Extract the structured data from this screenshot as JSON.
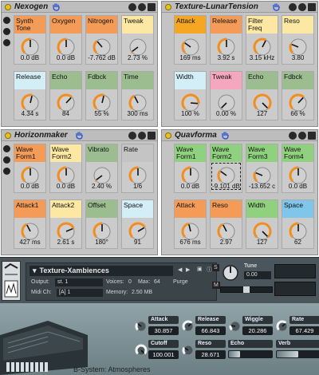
{
  "colors": {
    "orange": "#f49c57",
    "amber": "#f5a623",
    "yellow": "#fde8a3",
    "pink": "#f6a7c0",
    "green": "#8fd17e",
    "sage": "#9bbd8f",
    "lightblue": "#d4eef7",
    "sky": "#80c6ea",
    "grey": "#c4c4c4",
    "knob": "#f28d1e"
  },
  "racks": [
    {
      "name": "Nexogen",
      "macros": [
        {
          "label": "Synth Tone",
          "value": "0.0 dB",
          "color": "orange",
          "level": 0.5
        },
        {
          "label": "Oxygen",
          "value": "0.0 dB",
          "color": "orange",
          "level": 0.5
        },
        {
          "label": "Nitrogen",
          "value": "-7.762 dB",
          "color": "orange",
          "level": 0.35
        },
        {
          "label": "Tweak",
          "value": "2.73 %",
          "color": "yellow",
          "level": 0.03
        },
        {
          "label": "Release",
          "value": "4.34 s",
          "color": "lightblue",
          "level": 0.55
        },
        {
          "label": "Echo",
          "value": "84",
          "color": "sage",
          "level": 0.66
        },
        {
          "label": "Fdbck",
          "value": "55 %",
          "color": "sage",
          "level": 0.55
        },
        {
          "label": "Time",
          "value": "300 ms",
          "color": "sage",
          "level": 0.4
        }
      ]
    },
    {
      "name": "Texture-LunarTension",
      "macros": [
        {
          "label": "Attack",
          "value": "169 ms",
          "color": "amber",
          "level": 0.3
        },
        {
          "label": "Release",
          "value": "3.92 s",
          "color": "orange",
          "level": 0.5
        },
        {
          "label": "Filter Freq",
          "value": "3.15 kHz",
          "color": "yellow",
          "level": 0.6
        },
        {
          "label": "Reso",
          "value": "3.80",
          "color": "yellow",
          "level": 0.25
        },
        {
          "label": "Width",
          "value": "100 %",
          "color": "lightblue",
          "level": 0.85
        },
        {
          "label": "Tweak",
          "value": "0.00 %",
          "color": "pink",
          "level": 0.0
        },
        {
          "label": "Echo",
          "value": "127",
          "color": "sage",
          "level": 1.0
        },
        {
          "label": "Fdbck",
          "value": "66 %",
          "color": "sage",
          "level": 0.66
        }
      ]
    },
    {
      "name": "Horizonmaker",
      "macros": [
        {
          "label": "Wave Form1",
          "value": "0.0 dB",
          "color": "orange",
          "level": 0.5
        },
        {
          "label": "Wave Form2",
          "value": "0.0 dB",
          "color": "yellow",
          "level": 0.5
        },
        {
          "label": "Vibrato",
          "value": "2.40 %",
          "color": "sage",
          "level": 0.03
        },
        {
          "label": "Rate",
          "value": "1/6",
          "color": "grey",
          "level": 0.5
        },
        {
          "label": "Attack1",
          "value": "427 ms",
          "color": "orange",
          "level": 0.4
        },
        {
          "label": "Attack2",
          "value": "2.61 s",
          "color": "yellow",
          "level": 0.75
        },
        {
          "label": "Offset",
          "value": "180°",
          "color": "sage",
          "level": 0.5
        },
        {
          "label": "Space",
          "value": "91",
          "color": "lightblue",
          "level": 0.72
        }
      ]
    },
    {
      "name": "Quavforma",
      "macros": [
        {
          "label": "Wave Form1",
          "value": "0.0 dB",
          "color": "green",
          "level": 0.5
        },
        {
          "label": "Wave Form2",
          "value": "-9.101 dB",
          "color": "green",
          "level": 0.3
        },
        {
          "label": "Wave Form3",
          "value": "-13.652 c",
          "color": "green",
          "level": 0.25
        },
        {
          "label": "Wave Form4",
          "value": "0.0 dB",
          "color": "green",
          "level": 0.5
        },
        {
          "label": "Attack",
          "value": "676 ms",
          "color": "orange",
          "level": 0.45
        },
        {
          "label": "Reso",
          "value": "2.97",
          "color": "orange",
          "level": 0.4
        },
        {
          "label": "Width",
          "value": "127",
          "color": "green",
          "level": 1.0
        },
        {
          "label": "Space",
          "value": "62",
          "color": "sky",
          "level": 0.5
        }
      ]
    }
  ],
  "kontakt": {
    "instrument_name": "Texture-Xambiences",
    "output_label": "Output:",
    "output_value": "st. 1",
    "voices_label": "Voices:",
    "voices_value": "0",
    "max_label": "Max:",
    "max_value": "64",
    "purge_label": "Purge",
    "midi_label": "Midi Ch:",
    "midi_value": "[A] 1",
    "memory_label": "Memory:",
    "memory_value": "2.50 MB",
    "tune_label": "Tune",
    "tune_value": "0.00",
    "caption": "B-System: Atmospheres",
    "controls": [
      {
        "label": "Attack",
        "value": "30.857",
        "level": 0.3
      },
      {
        "label": "Release",
        "value": "66.843",
        "level": 0.67
      },
      {
        "label": "Wiggle",
        "value": "20.286",
        "level": 0.2
      },
      {
        "label": "Rate",
        "value": "67.429",
        "level": 0.67
      },
      {
        "label": "Cutoff",
        "value": "100.001",
        "level": 1.0
      },
      {
        "label": "Reso",
        "value": "28.671",
        "level": 0.29
      }
    ],
    "sliders": [
      {
        "label": "Echo",
        "level": 0.25
      },
      {
        "label": "Verb",
        "level": 0.5
      }
    ]
  }
}
